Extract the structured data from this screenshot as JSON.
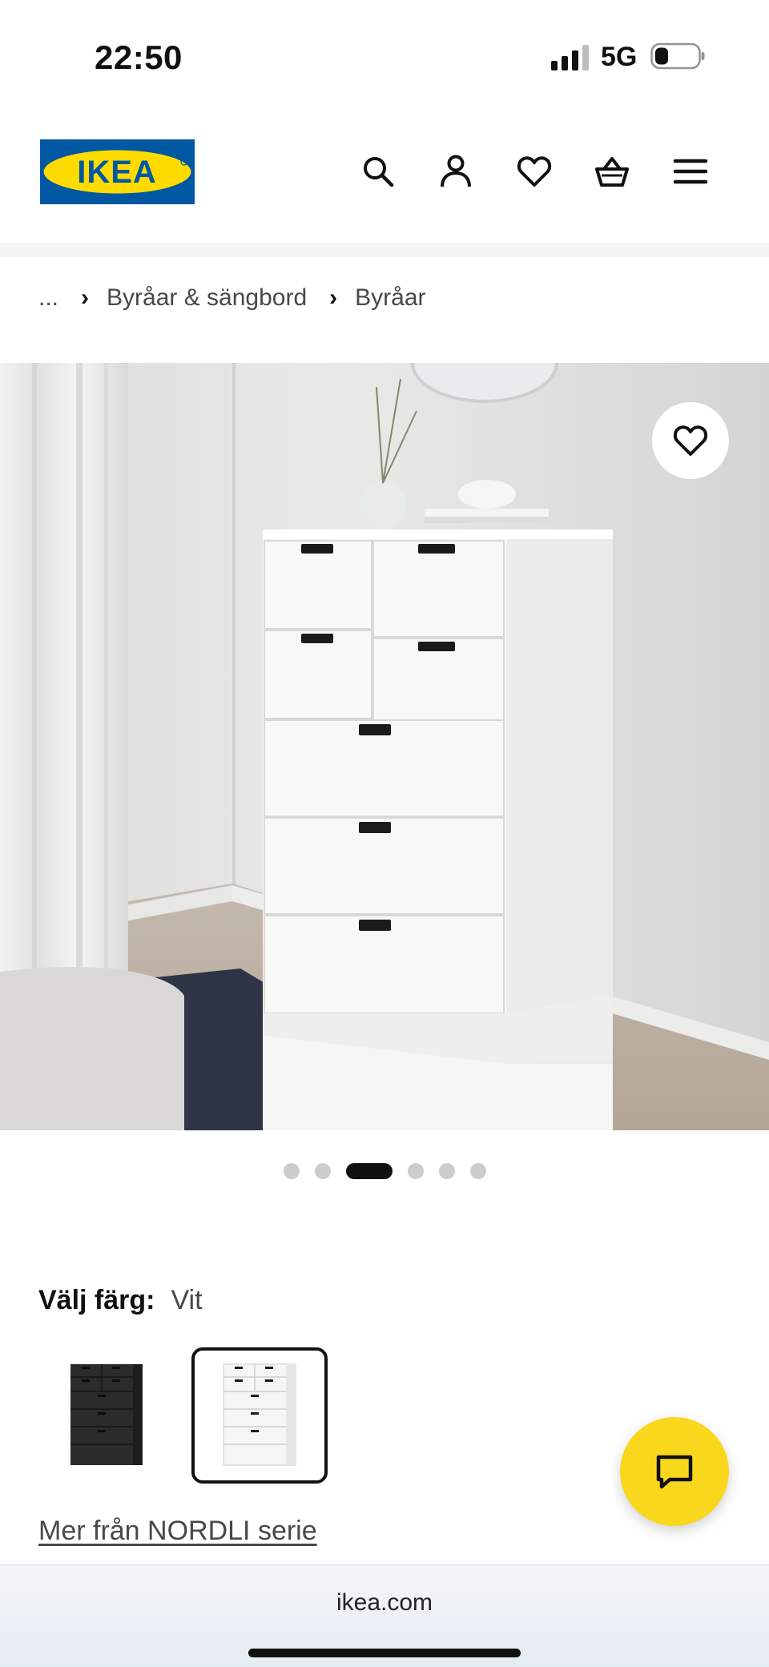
{
  "status_bar": {
    "time": "22:50",
    "network": "5G"
  },
  "header": {
    "logo_text": "IKEA",
    "icons": [
      "search-icon",
      "user-icon",
      "heart-icon",
      "basket-icon",
      "menu-icon"
    ]
  },
  "breadcrumb": {
    "items": [
      "...",
      "Byråar & sängbord",
      "Byråar"
    ]
  },
  "carousel": {
    "total": 6,
    "active_index": 2
  },
  "color_selector": {
    "label": "Välj färg:",
    "selected": "Vit",
    "options": [
      {
        "name": "black-brown",
        "color": "#2b2b2b"
      },
      {
        "name": "white",
        "color": "#f4f4f4"
      }
    ]
  },
  "series_link": "Mer från NORDLI serie",
  "browser": {
    "url": "ikea.com"
  },
  "colors": {
    "brand_blue": "#0058a3",
    "brand_yellow": "#ffdb00",
    "chat_yellow": "#f9d71c"
  }
}
